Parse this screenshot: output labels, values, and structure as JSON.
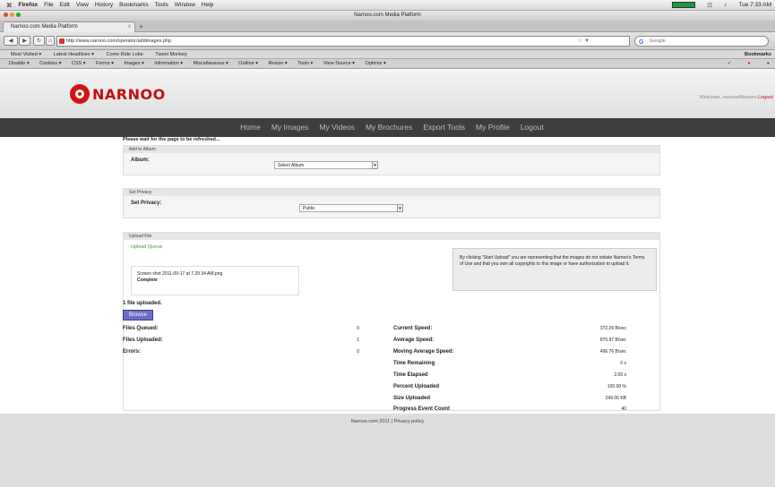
{
  "mac_menu": {
    "apple": "⌘",
    "items": [
      "Firefox",
      "File",
      "Edit",
      "View",
      "History",
      "Bookmarks",
      "Tools",
      "Window",
      "Help"
    ],
    "right_time": "Tue 7:33 AM"
  },
  "window": {
    "title": "Narnoo.com Media Platform"
  },
  "tab": {
    "label": "Narnoo.com Media Platform",
    "close": "x",
    "new": "+"
  },
  "nav": {
    "back": "◀",
    "forward": "▶",
    "reload": "↻",
    "url": "http://www.narnoo.com/operator/addimages.php",
    "search_engine": "G",
    "search_placeholder": "Google"
  },
  "bookmarks": {
    "items": [
      "Most Visited ▾",
      "Latest Headlines ▾",
      "Come Ride Lobe",
      "Tweet Monkey"
    ],
    "right": "Bookmarks"
  },
  "toolbar2": {
    "items": [
      "Disable ▾",
      "Cookies ▾",
      "CSS ▾",
      "Forms ▾",
      "Images ▾",
      "Information ▾",
      "Miscellaneous ▾",
      "Outline ▾",
      "Resize ▾",
      "Tools ▾",
      "View Source ▾",
      "Options ▾"
    ]
  },
  "brand": {
    "name": "NARNOO"
  },
  "header": {
    "welcome_text": "Welcome, narnoo4Narnoo",
    "logout_link": "Logout"
  },
  "main_nav": [
    "Home",
    "My Images",
    "My Videos",
    "My Brochures",
    "Export Tools",
    "My Profile",
    "Logout"
  ],
  "wait_notice": "Please wait for the page to be refreshed...",
  "album_panel": {
    "title": "Add to Album",
    "label": "Album:",
    "value": "Select Album"
  },
  "privacy_panel": {
    "title": "Set Privacy",
    "label": "Set Privacy:",
    "value": "Public"
  },
  "upload_panel": {
    "title": "Upload File",
    "queue_label": "Upload Queue",
    "queue_item": "Screen shot 2011-09-17 at 7.29.34 AM.png",
    "queue_status": "Complete",
    "note": "By clicking \"Start Upload\" you are representing that the images do not violate Narnoo's Terms of Use and that you own all copyrights to this image or have authorization to upload it.",
    "files_uploaded_text": "1 file uploaded.",
    "browse_label": "Browse"
  },
  "stats_left": [
    {
      "label": "Files Queued:",
      "value": "0"
    },
    {
      "label": "Files Uploaded:",
      "value": "1"
    },
    {
      "label": "Errors:",
      "value": "0"
    }
  ],
  "stats_right": [
    {
      "label": "Current Speed:",
      "value": "372.26 B/sec"
    },
    {
      "label": "Average Speed:",
      "value": "870.97 B/sec"
    },
    {
      "label": "Moving Average Speed:",
      "value": "496.76 B/sec"
    },
    {
      "label": "Time Remaining",
      "value": "0 s"
    },
    {
      "label": "Time Elapsed",
      "value": "2.00 s"
    },
    {
      "label": "Percent Uploaded",
      "value": "100.00 %"
    },
    {
      "label": "Size Uploaded",
      "value": "249.06 KB"
    },
    {
      "label": "Progress Event Count",
      "value": "40"
    }
  ],
  "footer": {
    "text": "Narnoo.com 2011 | Privacy policy"
  }
}
